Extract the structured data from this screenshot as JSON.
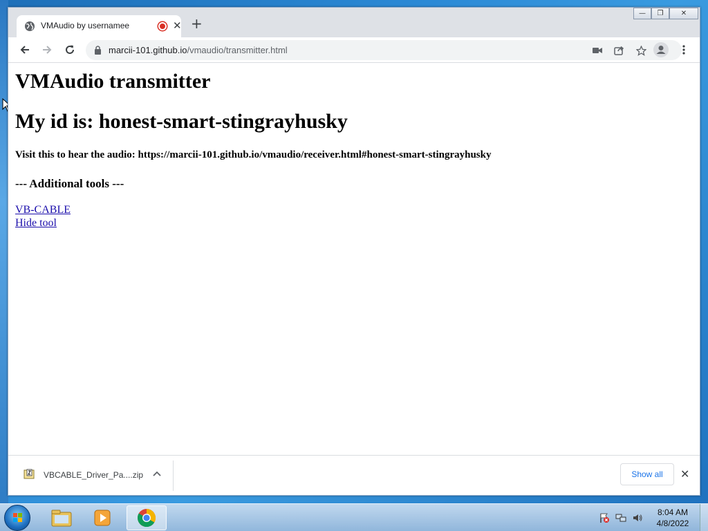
{
  "browser": {
    "tab": {
      "title": "VMAudio by usernamee"
    },
    "window_controls": {
      "minimize": "—",
      "maximize": "❐",
      "close": "✕"
    },
    "url": {
      "host": "marcii-101.github.io",
      "path": "/vmaudio/transmitter.html"
    }
  },
  "page": {
    "heading": "VMAudio transmitter",
    "id_heading": "My id is: honest-smart-stingrayhusky",
    "visit_text": "Visit this to hear the audio: https://marcii-101.github.io/vmaudio/receiver.html#honest-smart-stingrayhusky",
    "tools_heading": "--- Additional tools ---",
    "links": [
      "VB-CABLE",
      "Hide tool"
    ]
  },
  "download_bar": {
    "file_name": "VBCABLE_Driver_Pa....zip",
    "show_all": "Show all"
  },
  "taskbar": {
    "time": "8:04 AM",
    "date": "4/8/2022"
  },
  "colors": {
    "link": "#1a0dab",
    "show_all": "#1a73e8",
    "record_dot": "#d93025"
  }
}
